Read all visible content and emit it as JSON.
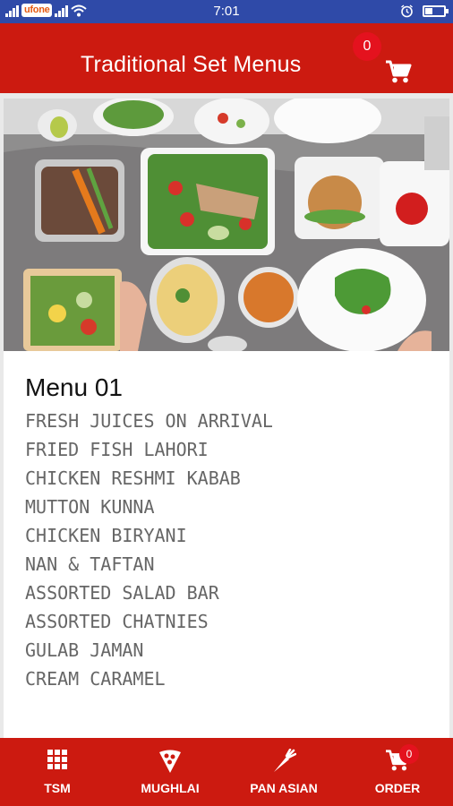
{
  "status_bar": {
    "carrier": "ufone",
    "time": "7:01"
  },
  "header": {
    "title": "Traditional Set Menus",
    "cart_count": "0"
  },
  "menu": {
    "title": "Menu 01",
    "items": [
      "FRESH JUICES ON ARRIVAL",
      "FRIED FISH LAHORI",
      "CHICKEN RESHMI KABAB",
      "MUTTON KUNNA",
      "CHICKEN BIRYANI",
      "NAN & TAFTAN",
      "ASSORTED SALAD BAR",
      "ASSORTED CHATNIES",
      "GULAB JAMAN",
      "CREAM CARAMEL"
    ]
  },
  "bottom_nav": {
    "items": [
      {
        "label": "TSM",
        "icon": "grid-icon"
      },
      {
        "label": "MUGHLAI",
        "icon": "pizza-icon"
      },
      {
        "label": "PAN ASIAN",
        "icon": "carrot-icon"
      },
      {
        "label": "ORDER",
        "icon": "cart-icon",
        "badge": "0"
      }
    ]
  },
  "colors": {
    "primary": "#cc1a10",
    "badge": "#e4121e",
    "status_bar": "#2f4aa8"
  }
}
